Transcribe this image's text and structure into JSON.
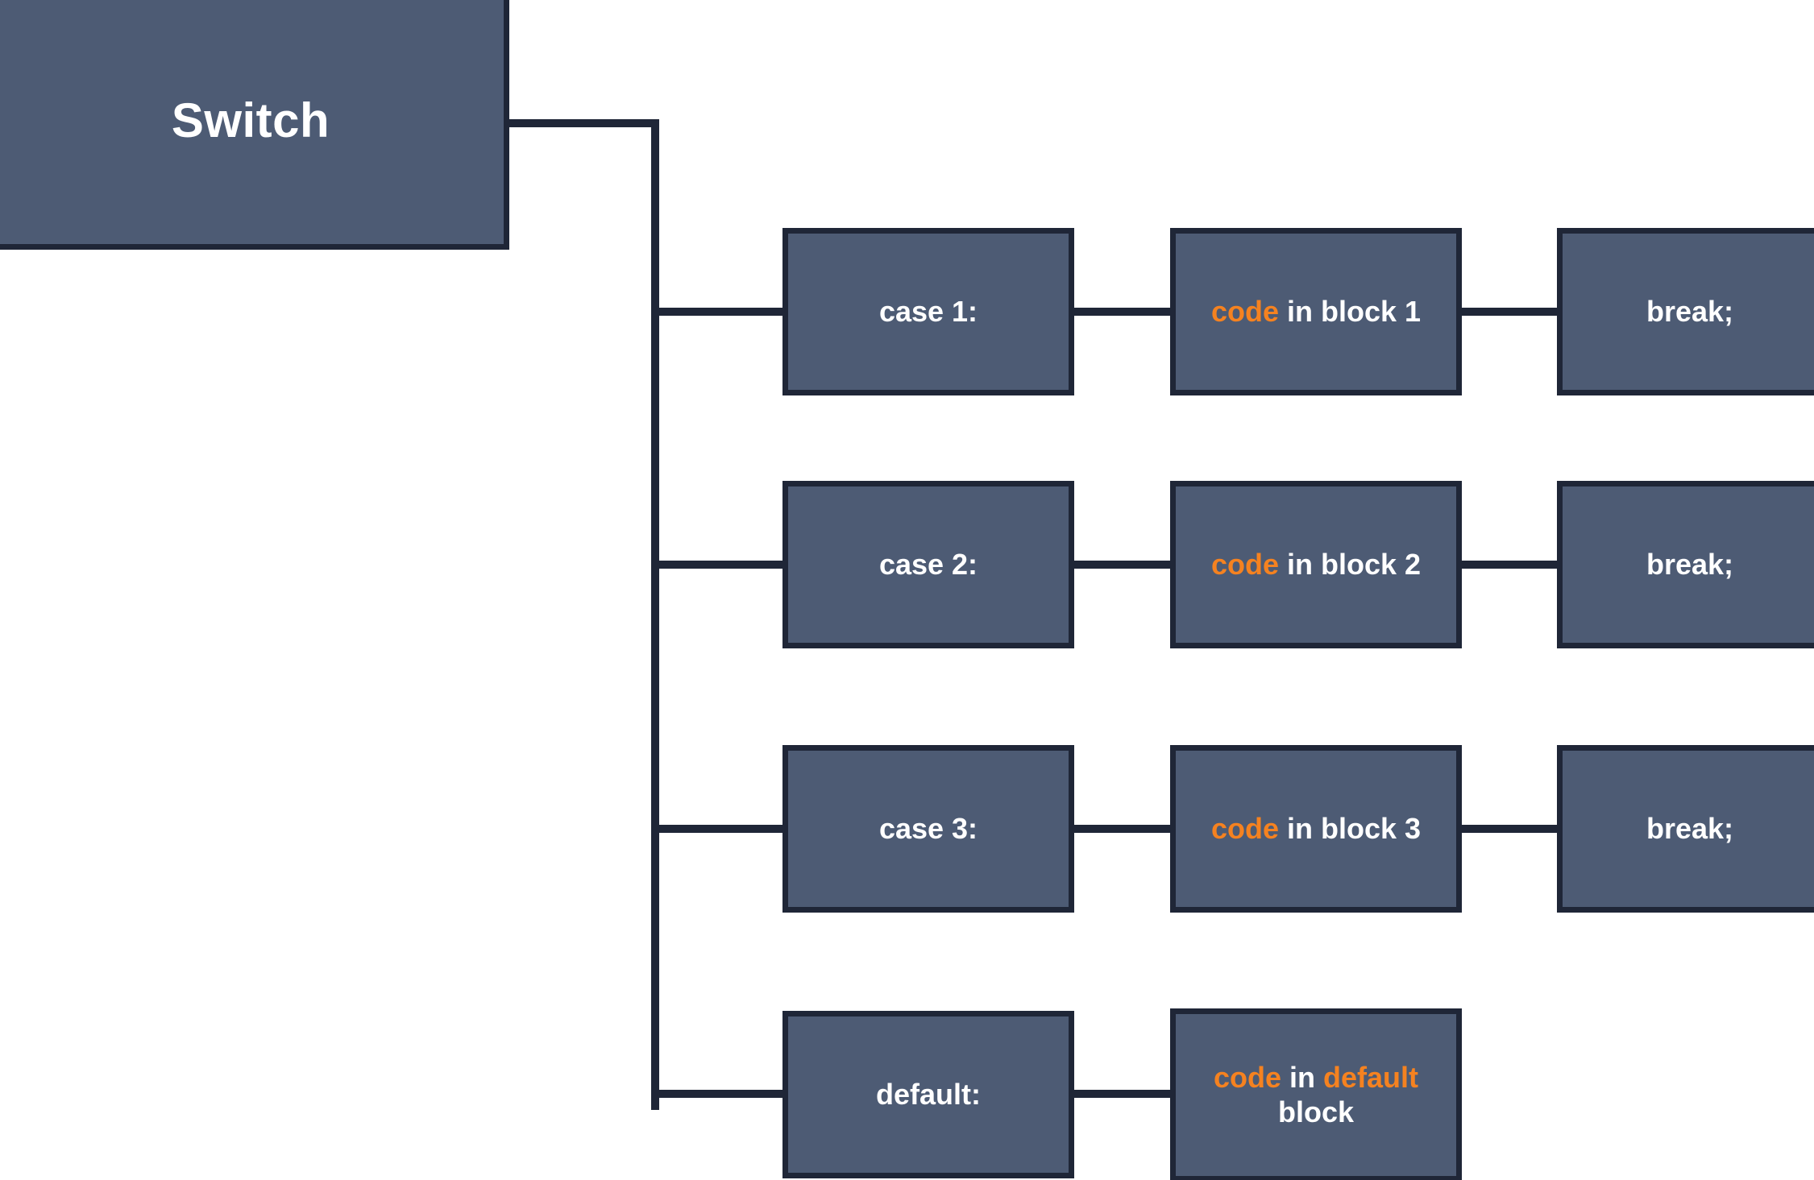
{
  "diagram": {
    "title_node": {
      "label": "Switch"
    },
    "colors": {
      "box_fill": "#4D5B74",
      "box_border": "#1F2637",
      "line": "#1F2637",
      "text": "#FFFFFF",
      "keyword": "#F58220",
      "background": "#FFFFFF"
    },
    "branches": [
      {
        "case_label": "case 1:",
        "code_keyword": "code",
        "code_rest": " in block 1",
        "break_label": "break;"
      },
      {
        "case_label": "case 2:",
        "code_keyword": "code",
        "code_rest": " in block 2",
        "break_label": "break;"
      },
      {
        "case_label": "case 3:",
        "code_keyword": "code",
        "code_rest": " in block 3",
        "break_label": "break;"
      }
    ],
    "default_branch": {
      "case_label": "default:",
      "code_keyword": "code",
      "code_middle": " in ",
      "code_keyword2": "default",
      "code_rest": "block"
    }
  }
}
